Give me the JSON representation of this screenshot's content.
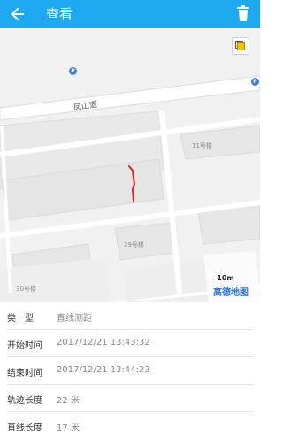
{
  "appbar": {
    "title": "查看",
    "back_icon": "arrow-left-icon",
    "delete_icon": "trash-icon",
    "color": "#1ea8f0"
  },
  "map": {
    "road_name": "凤山道",
    "building_labels": [
      "11号楼",
      "29号楼",
      "30号楼"
    ],
    "scale_label": "10m",
    "provider_logo": "高德地图",
    "poi_icon": "parking-icon",
    "poi_letter": "P",
    "layer_icon": "layers-icon",
    "track_color": "#e02020"
  },
  "details": [
    {
      "label": "类　型",
      "value": "直线测距"
    },
    {
      "label": "开始时间",
      "value": "2017/12/21 13:43:32"
    },
    {
      "label": "结束时间",
      "value": "2017/12/21 13:44:23"
    },
    {
      "label": "轨迹长度",
      "value": "22 米"
    },
    {
      "label": "直线长度",
      "value": "17 米"
    }
  ]
}
